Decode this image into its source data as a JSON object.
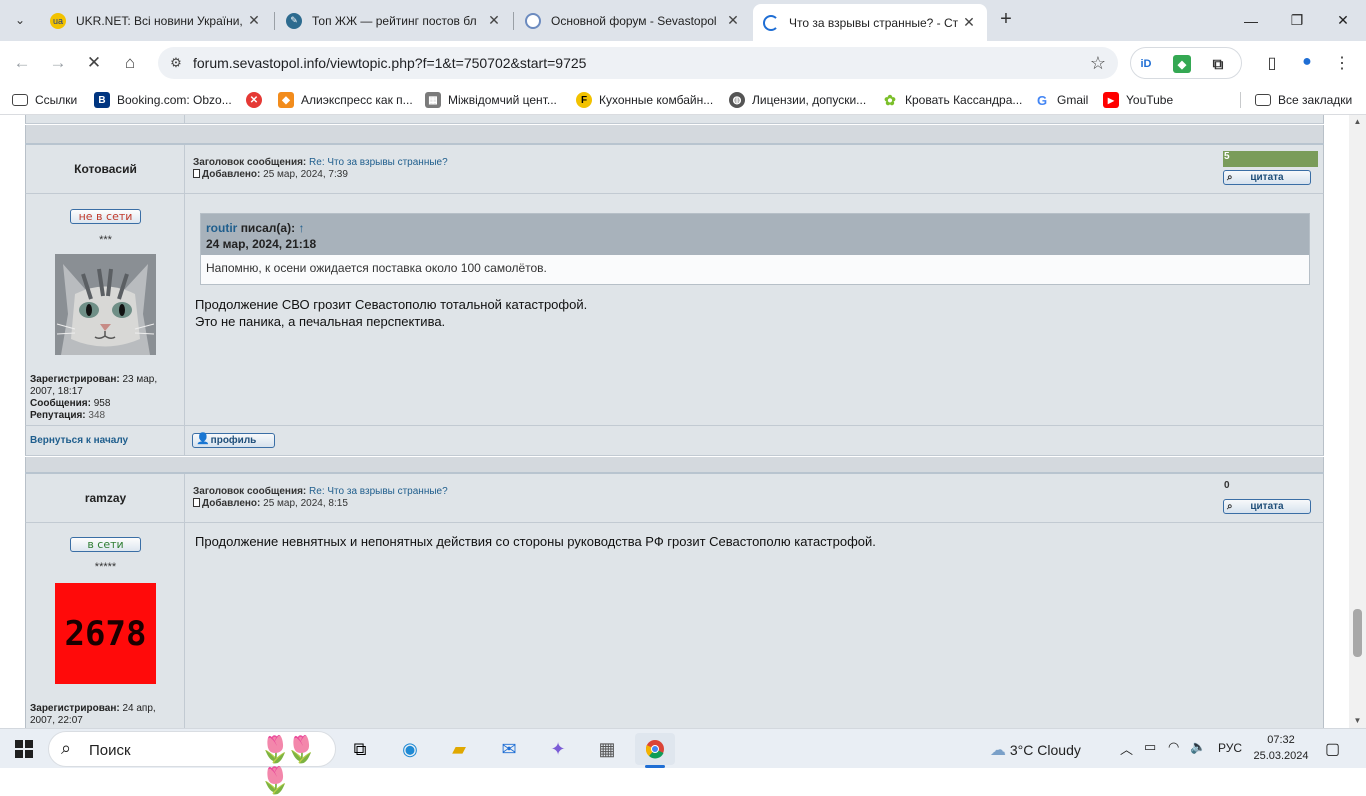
{
  "browser": {
    "tabs": [
      {
        "title": "UKR.NET: Всі новини України, ",
        "icon": "ukrnet-icon"
      },
      {
        "title": "Топ ЖЖ — рейтинг постов бл",
        "icon": "livejournal-icon"
      },
      {
        "title": "Основной форум - Sevastopol",
        "icon": "forum-icon"
      },
      {
        "title": "Что за взрывы странные? - Ст",
        "icon": "loading-icon"
      }
    ],
    "active_tab_index": 3,
    "url": "forum.sevastopol.info/viewtopic.php?f=1&t=750702&start=9725",
    "bookmarks": [
      {
        "label": "Ссылки",
        "icon": "folder-icon"
      },
      {
        "label": "Booking.com: Obzo...",
        "icon": "booking-icon"
      },
      {
        "label": "",
        "icon": "red-x-icon"
      },
      {
        "label": "Алиэкспресс как п...",
        "icon": "aliexpress-icon"
      },
      {
        "label": "Міжвідомчий цент...",
        "icon": "center-icon"
      },
      {
        "label": "Кухонные комбайн...",
        "icon": "foxtrot-icon"
      },
      {
        "label": "Лицензии, допуски...",
        "icon": "globe-icon"
      },
      {
        "label": "Кровать Кассандра...",
        "icon": "flower-icon"
      },
      {
        "label": "Gmail",
        "icon": "google-icon"
      },
      {
        "label": "YouTube",
        "icon": "youtube-icon"
      }
    ],
    "all_bookmarks": "Все закладки"
  },
  "posts": [
    {
      "author": "Котовасий",
      "subject_label": "Заголовок сообщения:",
      "subject": "Re: Что за взрывы странные?",
      "added_label": "Добавлено:",
      "added": "25 мар, 2024, 7:39",
      "reputation": "5",
      "quote_button": "цитата",
      "status": "не в сети",
      "status_color": "#c0392b",
      "stars": "***",
      "registered_label": "Зарегистрирован:",
      "registered": "23 мар, 2007, 18:17",
      "messages_label": "Сообщения:",
      "messages": "958",
      "reputation_label": "Репутация:",
      "reputation_value": "348",
      "back_to_top": "Вернуться к началу",
      "profile_button": "профиль",
      "quote": {
        "author": "routir",
        "wrote": "писал(а):",
        "arrow": "↑",
        "date": "24 мар, 2024, 21:18",
        "text": "Напомню, к осени ожидается поставка около 100 самолётов."
      },
      "text_lines": [
        "Продолжение СВО грозит Севастополю тотальной катастрофой.",
        "Это не паника, а печальная перспектива."
      ]
    },
    {
      "author": "ramzay",
      "subject_label": "Заголовок сообщения:",
      "subject": "Re: Что за взрывы странные?",
      "added_label": "Добавлено:",
      "added": "25 мар, 2024, 8:15",
      "reputation": "0",
      "quote_button": "цитата",
      "status": "в сети",
      "status_color": "#2e7d32",
      "stars": "*****",
      "avatar_text": "2678",
      "registered_label": "Зарегистрирован:",
      "registered": "24 апр, 2007, 22:07",
      "text_lines": [
        "Продолжение невнятных и непонятных действия со стороны руководства РФ грозит Севастополю катастрофой."
      ]
    }
  ],
  "taskbar": {
    "search_placeholder": "Поиск",
    "weather": "3°C  Cloudy",
    "language": "РУС",
    "time": "07:32",
    "date": "25.03.2024"
  }
}
